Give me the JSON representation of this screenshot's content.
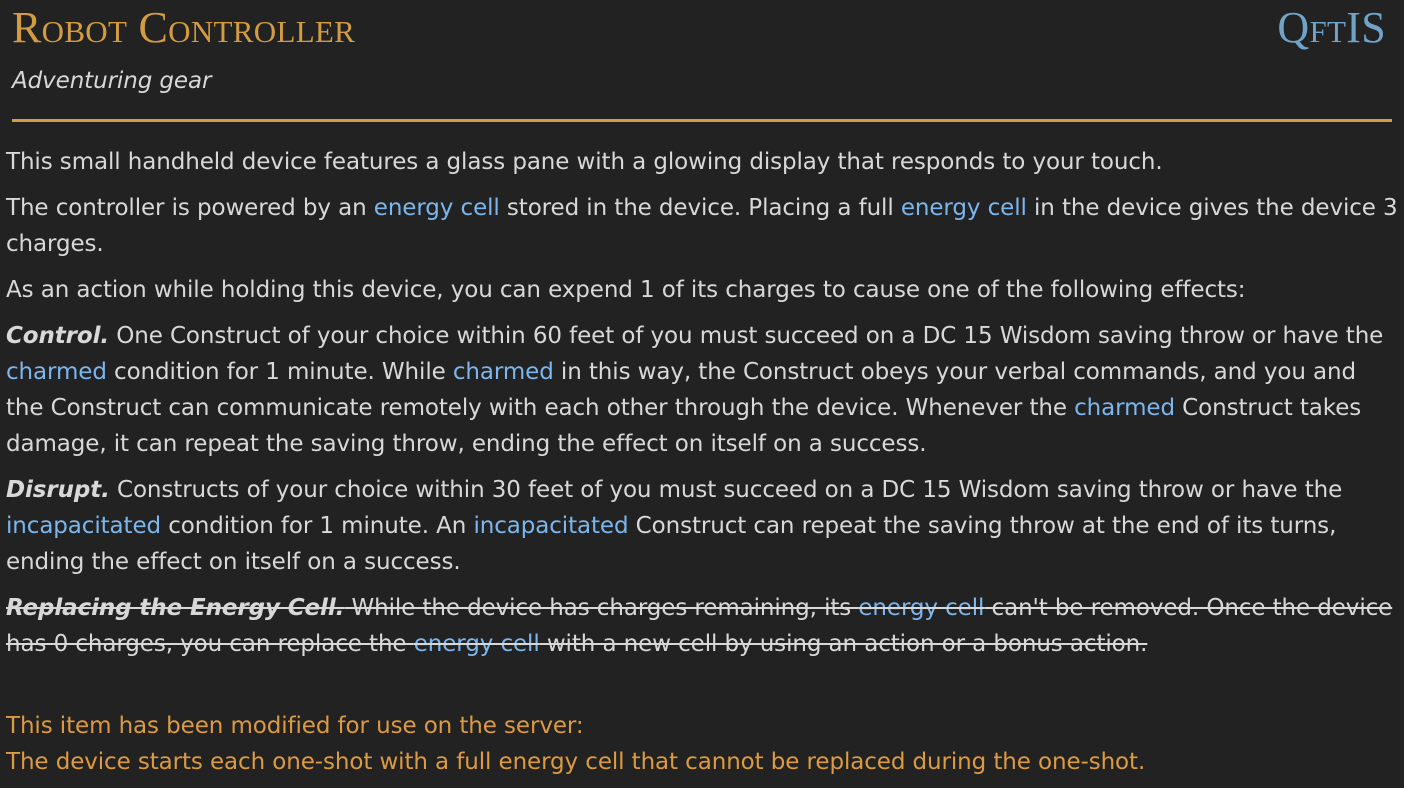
{
  "header": {
    "title": "Robot Controller",
    "source": "QftIS",
    "subtitle": "Adventuring gear"
  },
  "colors": {
    "accent": "#d49c40",
    "link": "#7cb6ee",
    "source": "#6fa4c8",
    "note": "#dd9a40",
    "background": "#222222",
    "text": "#d8d8d8"
  },
  "intro": {
    "p1": "This small handheld device features a glass pane with a glowing display that responds to your touch.",
    "p2_a": "The controller is powered by an ",
    "p2_link1": "energy cell",
    "p2_b": " stored in the device. Placing a full ",
    "p2_link2": "energy cell",
    "p2_c": " in the device gives the device 3 charges.",
    "p3": "As an action while holding this device, you can expend 1 of its charges to cause one of the following effects:"
  },
  "control": {
    "label": "Control.",
    "a": " One Construct of your choice within 60 feet of you must succeed on a DC 15 Wisdom saving throw or have the ",
    "link1": "charmed",
    "b": " condition for 1 minute. While ",
    "link2": "charmed",
    "c": " in this way, the Construct obeys your verbal commands, and you and the Construct can communicate remotely with each other through the device. Whenever the ",
    "link3": "charmed",
    "d": " Construct takes damage, it can repeat the saving throw, ending the effect on itself on a success."
  },
  "disrupt": {
    "label": "Disrupt.",
    "a": " Constructs of your choice within 30 feet of you must succeed on a DC 15 Wisdom saving throw or have the ",
    "link1": "incapacitated",
    "b": " condition for 1 minute. An ",
    "link2": "incapacitated",
    "c": " Construct can repeat the saving throw at the end of its turns, ending the effect on itself on a success."
  },
  "replacing": {
    "label": "Replacing the Energy Cell.",
    "a": " While the device has charges remaining, its ",
    "link1": "energy cell",
    "b": " can't be removed. Once the device has 0 charges, you can replace the ",
    "link2": "energy cell",
    "c": " with a new cell by using an action or a bonus action."
  },
  "note": {
    "line1": "This item has been modified for use on the server:",
    "line2": "The device starts each one-shot with a full energy cell that cannot be replaced during the one-shot."
  }
}
